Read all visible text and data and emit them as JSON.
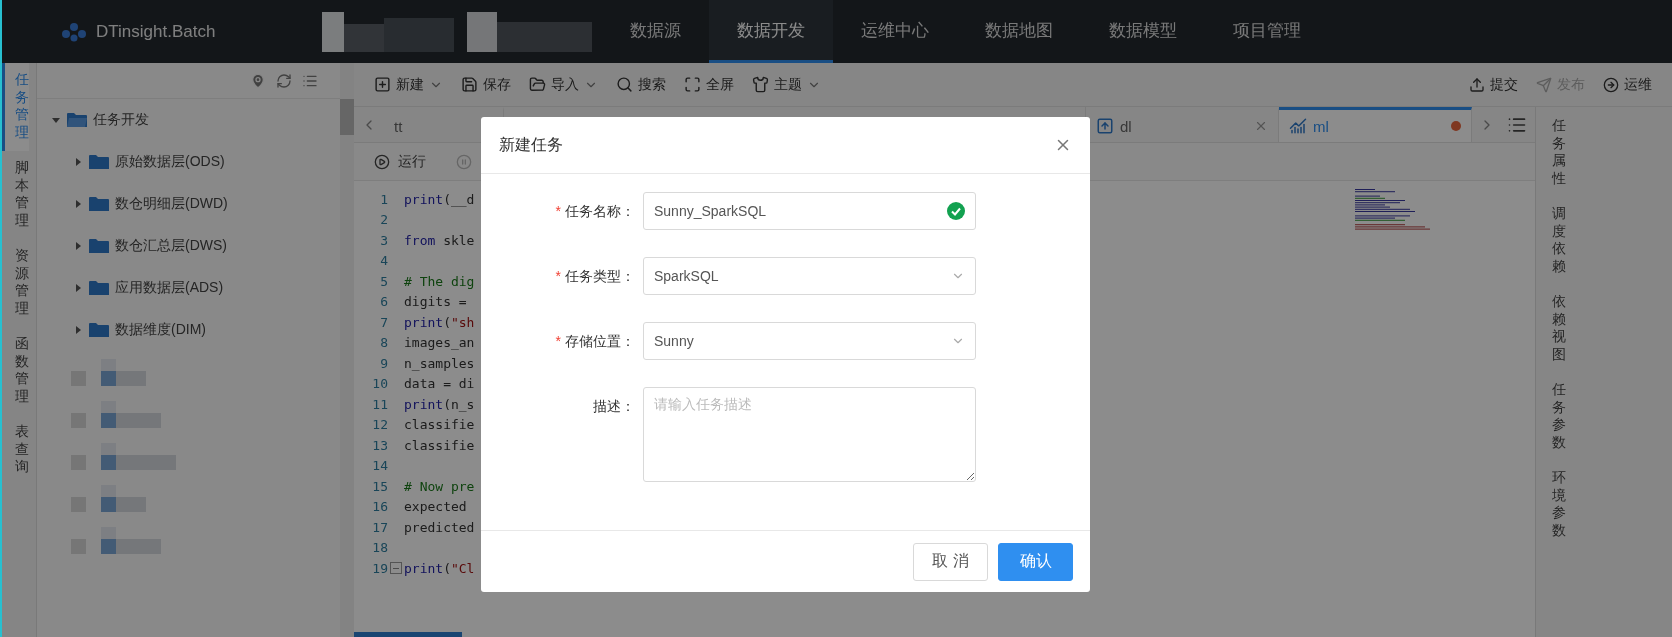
{
  "app": {
    "logo": "DTinsight.Batch"
  },
  "nav": [
    {
      "label": "数据源",
      "selected": false
    },
    {
      "label": "数据开发",
      "selected": true
    },
    {
      "label": "运维中心",
      "selected": false
    },
    {
      "label": "数据地图",
      "selected": false
    },
    {
      "label": "数据模型",
      "selected": false
    },
    {
      "label": "项目管理",
      "selected": false
    }
  ],
  "side_tabs": [
    {
      "label": "任务管理",
      "selected": true
    },
    {
      "label": "脚本管理",
      "selected": false
    },
    {
      "label": "资源管理",
      "selected": false
    },
    {
      "label": "函数管理",
      "selected": false
    },
    {
      "label": "表查询",
      "selected": false
    }
  ],
  "tree": {
    "label": "任务开发",
    "expanded": true,
    "children": [
      {
        "label": "原始数据层(ODS)",
        "expanded": false
      },
      {
        "label": "数仓明细层(DWD)",
        "expanded": false
      },
      {
        "label": "数仓汇总层(DWS)",
        "expanded": false
      },
      {
        "label": "应用数据层(ADS)",
        "expanded": false
      },
      {
        "label": "数据维度(DIM)",
        "expanded": false
      }
    ]
  },
  "toolbar": {
    "left": [
      {
        "label": "新建",
        "has_menu": true
      },
      {
        "label": "保存",
        "has_menu": false
      },
      {
        "label": "导入",
        "has_menu": true
      },
      {
        "label": "搜索",
        "has_menu": false
      },
      {
        "label": "全屏",
        "has_menu": false
      },
      {
        "label": "主题",
        "has_menu": true
      }
    ],
    "right": [
      {
        "label": "提交",
        "disabled": false
      },
      {
        "label": "发布",
        "disabled": true
      },
      {
        "label": "运维",
        "disabled": false
      }
    ]
  },
  "tabs": [
    {
      "label": "tt",
      "selected": false
    },
    {
      "label": "dl",
      "selected": false,
      "closable": true,
      "unsaved": false
    },
    {
      "label": "ml",
      "selected": true,
      "closable": false,
      "unsaved": true
    }
  ],
  "run_bar": [
    "运行"
  ],
  "code": [
    {
      "number": "1",
      "fold": false,
      "tokens": [
        {
          "text": "print",
          "kind": "keyword"
        },
        {
          "text": "(__d",
          "kind": "plain"
        }
      ]
    },
    {
      "number": "2",
      "fold": false
    },
    {
      "number": "3",
      "fold": false,
      "tokens": [
        {
          "text": "from",
          "kind": "keyword"
        },
        {
          "text": " skle",
          "kind": "plain"
        }
      ]
    },
    {
      "number": "4",
      "fold": false
    },
    {
      "number": "5",
      "fold": false,
      "tokens": [
        {
          "text": "# The dig",
          "kind": "comment"
        }
      ]
    },
    {
      "number": "6",
      "fold": false,
      "tokens": [
        {
          "text": "digits =",
          "kind": "plain"
        }
      ]
    },
    {
      "number": "7",
      "fold": false,
      "tokens": [
        {
          "text": "print",
          "kind": "keyword"
        },
        {
          "text": "(",
          "kind": "plain"
        },
        {
          "text": "\"sh",
          "kind": "string"
        }
      ]
    },
    {
      "number": "8",
      "fold": false,
      "tokens": [
        {
          "text": "images_an",
          "kind": "plain"
        }
      ]
    },
    {
      "number": "9",
      "fold": false,
      "tokens": [
        {
          "text": "n_samples",
          "kind": "plain"
        }
      ]
    },
    {
      "number": "10",
      "fold": false,
      "tokens": [
        {
          "text": "data = di",
          "kind": "plain"
        }
      ]
    },
    {
      "number": "11",
      "fold": false,
      "tokens": [
        {
          "text": "print",
          "kind": "keyword"
        },
        {
          "text": "(n_s",
          "kind": "plain"
        }
      ]
    },
    {
      "number": "12",
      "fold": false,
      "tokens": [
        {
          "text": "classifie",
          "kind": "plain"
        }
      ]
    },
    {
      "number": "13",
      "fold": false,
      "tokens": [
        {
          "text": "classifie",
          "kind": "plain"
        }
      ]
    },
    {
      "number": "14",
      "fold": false
    },
    {
      "number": "15",
      "fold": false,
      "tokens": [
        {
          "text": "# Now pre",
          "kind": "comment"
        }
      ]
    },
    {
      "number": "16",
      "fold": false,
      "tokens": [
        {
          "text": "expected",
          "kind": "plain"
        }
      ]
    },
    {
      "number": "17",
      "fold": false,
      "tokens": [
        {
          "text": "predicted",
          "kind": "plain"
        }
      ]
    },
    {
      "number": "18",
      "fold": false
    },
    {
      "number": "19",
      "fold": true,
      "tokens": [
        {
          "text": "print",
          "kind": "keyword"
        },
        {
          "text": "(",
          "kind": "plain"
        },
        {
          "text": "\"Cl",
          "kind": "string"
        }
      ]
    }
  ],
  "right_panel": [
    "任务属性",
    "调度依赖",
    "依赖视图",
    "任务参数",
    "环境参数"
  ],
  "dialog": {
    "title": "新建任务",
    "fields": [
      {
        "required_mark": "*",
        "label": "任务名称：",
        "kind": "input",
        "value": "Sunny_SparkSQL",
        "valid": true
      },
      {
        "required_mark": "*",
        "label": "任务类型：",
        "kind": "select",
        "value": "SparkSQL",
        "valid": false
      },
      {
        "required_mark": "*",
        "label": "存储位置：",
        "kind": "select",
        "value": "Sunny",
        "valid": false
      },
      {
        "label": "描述：",
        "kind": "textarea",
        "placeholder": "请输入任务描述",
        "valid": false
      }
    ],
    "buttons": [
      {
        "label": "取 消",
        "primary": false
      },
      {
        "label": "确认",
        "primary": true
      }
    ]
  }
}
